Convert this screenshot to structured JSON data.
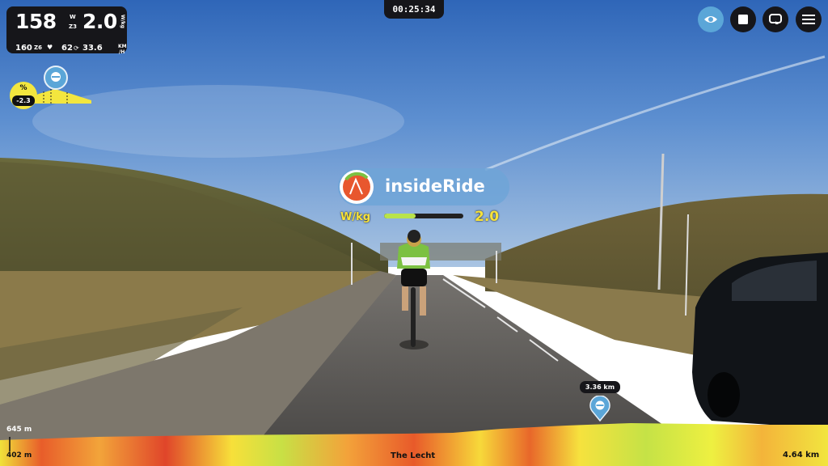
{
  "hud": {
    "power": "158",
    "power_unit_top": "W",
    "zone": "Z3",
    "wkg": "2.0",
    "wkg_unit": "W/kg",
    "heart_rate": "160",
    "hr_zone": "Z6",
    "cadence": "62",
    "speed": "33.6",
    "speed_unit_top": "KM",
    "speed_unit_bottom": "/H"
  },
  "timer": "00:25:34",
  "gradient": {
    "symbol": "%",
    "value": "-2.3"
  },
  "overlay": {
    "brand": "insideRide",
    "wkg_label": "W/kg",
    "wkg_value": "2.0",
    "wkg_progress": 0.4
  },
  "toolbar": {
    "buttons": [
      {
        "icon": "eye-icon",
        "active": true
      },
      {
        "icon": "stop-icon",
        "active": false
      },
      {
        "icon": "loop-icon",
        "active": false
      },
      {
        "icon": "menu-icon",
        "active": false
      }
    ]
  },
  "profile": {
    "max_elevation": "645 m",
    "min_elevation": "402 m",
    "route_name": "The Lecht",
    "total_distance": "4.64 km",
    "rider_distance": "3.36 km"
  },
  "colors": {
    "hud_bg": "#16161a",
    "active_button": "#5ba6d8",
    "wkg_yellow": "#f7e23a",
    "wkg_fill": "#b9e34a"
  }
}
